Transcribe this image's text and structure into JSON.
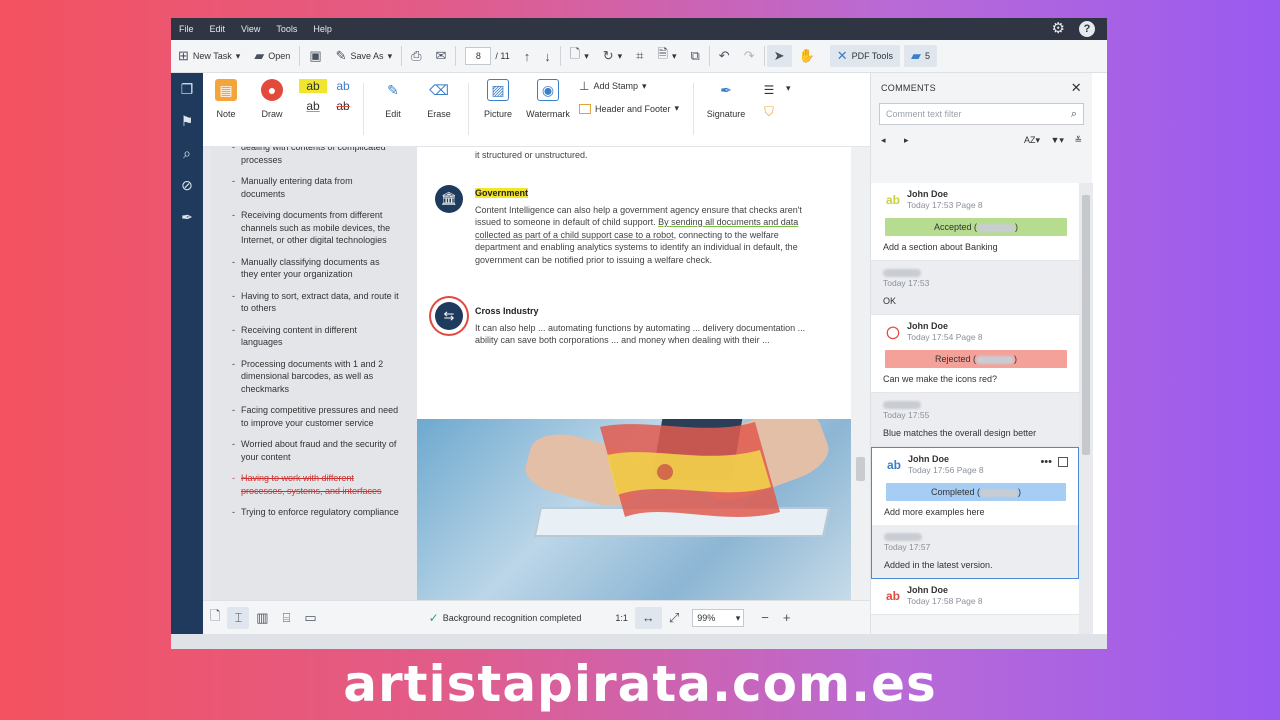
{
  "menubar": {
    "items": [
      "File",
      "Edit",
      "View",
      "Tools",
      "Help"
    ],
    "help_glyph": "?"
  },
  "toolbar": {
    "new_task": "New Task",
    "open": "Open",
    "save_as": "Save As",
    "page_current": "8",
    "page_total": "/ 11",
    "pdf_tools": "PDF Tools",
    "comments_count": "5"
  },
  "ribbon": {
    "note": "Note",
    "draw": "Draw",
    "ab": "ab",
    "edit": "Edit",
    "erase": "Erase",
    "picture": "Picture",
    "watermark": "Watermark",
    "add_stamp": "Add Stamp",
    "header_footer": "Header and Footer",
    "signature": "Signature"
  },
  "left_page": {
    "items": [
      {
        "text": "dealing with contents of complicated processes",
        "strike": false
      },
      {
        "text": "Manually entering data from documents",
        "strike": false
      },
      {
        "text": "Receiving documents from different channels such as mobile devices, the Internet, or other digital technologies",
        "strike": false
      },
      {
        "text": "Manually classifying documents as they enter your organization",
        "strike": false
      },
      {
        "text": "Having to sort, extract data, and route it to others",
        "strike": false
      },
      {
        "text": "Receiving content in different languages",
        "strike": false
      },
      {
        "text": "Processing documents with 1 and 2 dimensional barcodes, as well as checkmarks",
        "strike": false
      },
      {
        "text": "Facing competitive pressures and need to improve your customer service",
        "strike": false
      },
      {
        "text": "Worried about fraud and the security of your content",
        "strike": false
      },
      {
        "text": "Having to work with different processes, systems, and interfaces",
        "strike": true
      },
      {
        "text": "Trying to enforce regulatory compliance",
        "strike": false
      }
    ]
  },
  "right_page": {
    "top_line": "it structured or unstructured.",
    "gov_title": "Government",
    "gov_text_1": "Content Intelligence can also help a government agency ensure that checks aren't issued to someone in default of child support.",
    "gov_text_2": "By sending all documents and data collected as part of a child support case to a robot,",
    "gov_text_3": "connecting to the welfare department and enabling analytics systems to identify an individual in default, the government can be notified prior to issuing a welfare check.",
    "ci_title": "Cross Industry",
    "ci_text": "It can also help ... automating functions by automating ... delivery documentation ... ability can save both corporations ... and money when dealing with their ..."
  },
  "statusbar": {
    "recognition": "Background recognition completed",
    "ratio": "1:1",
    "zoom": "99%"
  },
  "comments": {
    "header": "COMMENTS",
    "filter_placeholder": "Comment text filter",
    "sort_label": "AZ",
    "cards": [
      {
        "avatar": "ab",
        "avatar_color": "#c9d23a",
        "name": "John Doe",
        "time": "Today 17:53",
        "page": "Page 8",
        "status": "Accepted (",
        "status_color": "#b6dc8f",
        "text": "Add a section about Banking",
        "reply": false,
        "selected": false
      },
      {
        "avatar": "",
        "avatar_color": "",
        "name": "",
        "time": "Today 17:53",
        "page": "",
        "status": "",
        "status_color": "",
        "text": "OK",
        "reply": true,
        "selected": false
      },
      {
        "avatar": "◯",
        "avatar_color": "#e04a3f",
        "name": "John Doe",
        "time": "Today 17:54",
        "page": "Page 8",
        "status": "Rejected (",
        "status_color": "#f4a19a",
        "text": "Can we make the icons red?",
        "reply": false,
        "selected": false
      },
      {
        "avatar": "",
        "avatar_color": "",
        "name": "",
        "time": "Today 17:55",
        "page": "",
        "status": "",
        "status_color": "",
        "text": "Blue matches the overall design better",
        "reply": true,
        "selected": false
      },
      {
        "avatar": "ab",
        "avatar_color": "#3a7fc9",
        "name": "John Doe",
        "time": "Today 17:56",
        "page": "Page 8",
        "status": "Completed (",
        "status_color": "#a6cdf3",
        "text": "Add more examples here",
        "reply": false,
        "selected": true
      },
      {
        "avatar": "",
        "avatar_color": "",
        "name": "",
        "time": "Today 17:57",
        "page": "",
        "status": "",
        "status_color": "",
        "text": "Added in the latest version.",
        "reply": true,
        "selected": true
      },
      {
        "avatar": "ab",
        "avatar_color": "#e04a3f",
        "name": "John Doe",
        "time": "Today 17:58",
        "page": "Page 8",
        "status": "",
        "status_color": "",
        "text": "",
        "reply": false,
        "selected": false
      }
    ]
  },
  "watermark_text": "artistapirata.com.es",
  "colors": {
    "rail": "#1f3a5c",
    "menubar": "#2f3542",
    "accent": "#4a8ad6"
  }
}
